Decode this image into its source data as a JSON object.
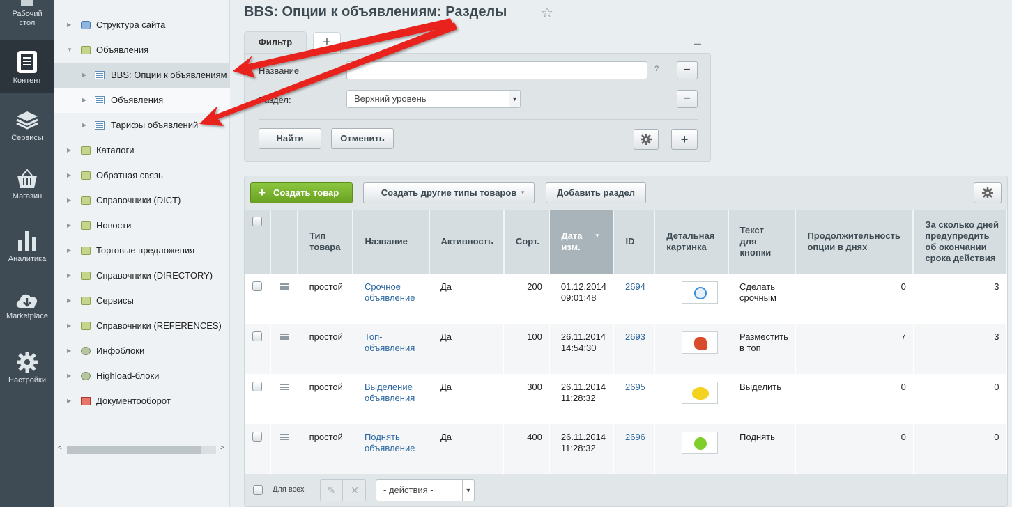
{
  "leftbar": {
    "items": [
      {
        "label_line1": "Рабочий",
        "label_line2": "стол",
        "icon": "desktop-icon"
      },
      {
        "label": "Контент",
        "icon": "content-icon"
      },
      {
        "label": "Сервисы",
        "icon": "layers-icon"
      },
      {
        "label": "Магазин",
        "icon": "basket-icon"
      },
      {
        "label": "Аналитика",
        "icon": "bar-chart-icon"
      },
      {
        "label": "Marketplace",
        "icon": "cloud-download-icon"
      },
      {
        "label": "Настройки",
        "icon": "gear-icon"
      }
    ]
  },
  "tree": {
    "items": [
      {
        "label": "Структура сайта"
      },
      {
        "label": "Объявления"
      },
      {
        "label": "BBS: Опции к объявлениям"
      },
      {
        "label": "Объявления"
      },
      {
        "label": "Тарифы объявлений"
      },
      {
        "label": "Каталоги"
      },
      {
        "label": "Обратная связь"
      },
      {
        "label": "Справочники (DICT)"
      },
      {
        "label": "Новости"
      },
      {
        "label": "Торговые предложения"
      },
      {
        "label": "Справочники (DIRECTORY)"
      },
      {
        "label": "Сервисы"
      },
      {
        "label": "Справочники (REFERENCES)"
      },
      {
        "label": "Инфоблоки"
      },
      {
        "label": "Highload-блоки"
      },
      {
        "label": "Документооборот"
      }
    ]
  },
  "page": {
    "title": "BBS: Опции к объявлениям: Разделы",
    "star": "☆"
  },
  "filter": {
    "tab_label": "Фильтр",
    "add_tab": "+",
    "collapse": "–",
    "name_label": "Название",
    "name_value": "",
    "help": "?",
    "section_label": "Раздел:",
    "section_value": "Верхний уровень",
    "find_button": "Найти",
    "cancel_button": "Отменить",
    "remove": "–",
    "add_field": "+"
  },
  "toolbar": {
    "create_label": "Создать товар",
    "other_types_label": "Создать другие типы товаров",
    "add_section_label": "Добавить раздел"
  },
  "table": {
    "headers": {
      "type": "Тип товара",
      "name": "Название",
      "active": "Активность",
      "sort": "Сорт.",
      "date": "Дата изм.",
      "id": "ID",
      "picture": "Детальная картинка",
      "button_text": "Текст для кнопки",
      "duration": "Продолжительность опции в днях",
      "notify_days": "За сколько дней предупредить об окончании срока действия"
    },
    "rows": [
      {
        "type": "простой",
        "name": "Срочное объявление",
        "active": "Да",
        "sort": "200",
        "date": "01.12.2014 09:01:48",
        "id": "2694",
        "picture_color": "#3a8fd8",
        "button_text": "Сделать срочным",
        "duration": "0",
        "notify_days": "3"
      },
      {
        "type": "простой",
        "name": "Топ-объявления",
        "active": "Да",
        "sort": "100",
        "date": "26.11.2014 14:54:30",
        "id": "2693",
        "picture_color": "#d94b2b",
        "button_text": "Разместить в топ",
        "duration": "7",
        "notify_days": "3"
      },
      {
        "type": "простой",
        "name": "Выделение объявления",
        "active": "Да",
        "sort": "300",
        "date": "26.11.2014 11:28:32",
        "id": "2695",
        "picture_color": "#f3d320",
        "button_text": "Выделить",
        "duration": "0",
        "notify_days": "0"
      },
      {
        "type": "простой",
        "name": "Поднять объявление",
        "active": "Да",
        "sort": "400",
        "date": "26.11.2014 11:28:32",
        "id": "2696",
        "picture_color": "#7fcf2a",
        "button_text": "Поднять",
        "duration": "0",
        "notify_days": "0"
      }
    ]
  },
  "footer": {
    "for_all": "Для всех",
    "actions_value": "- действия -"
  },
  "colors": {
    "accent_green": "#7bb52f",
    "link": "#2c67a0",
    "annotation_arrow": "#e8221b"
  }
}
